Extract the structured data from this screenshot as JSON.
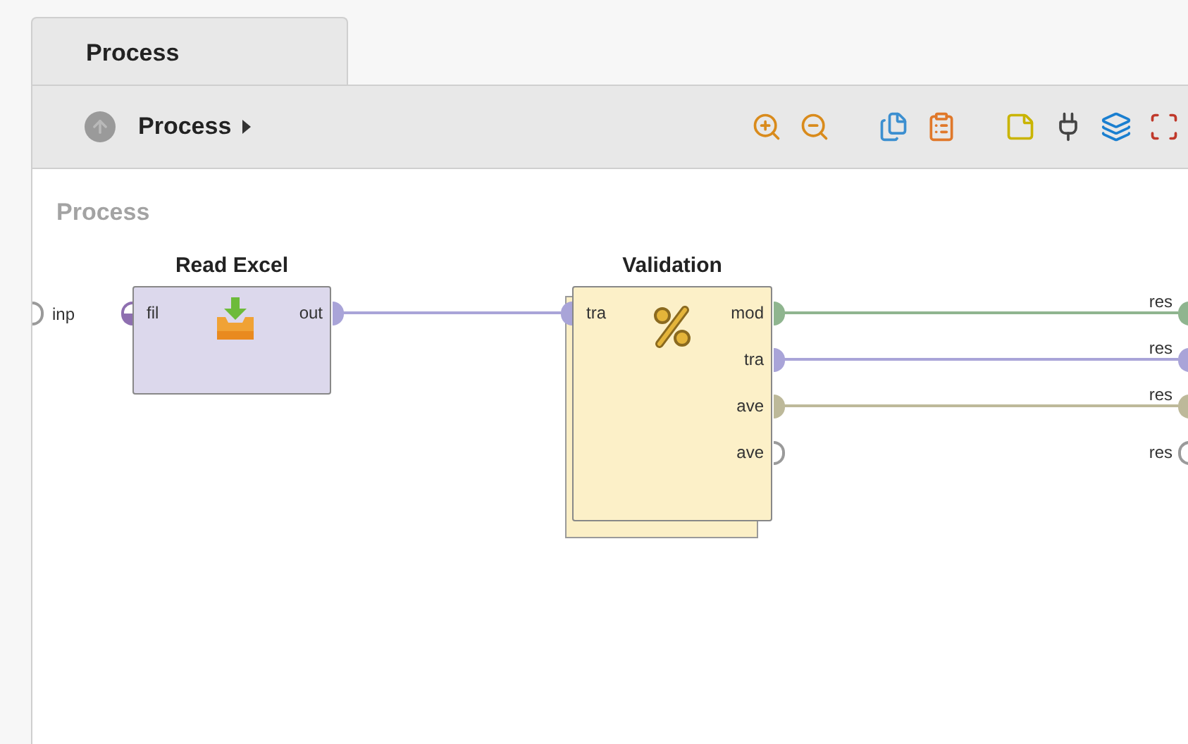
{
  "tabs": [
    {
      "label": "Process",
      "selected": true
    }
  ],
  "breadcrumb": {
    "label": "Process"
  },
  "canvas": {
    "label": "Process",
    "process_inputs": [
      {
        "label": "inp",
        "kind": "empty"
      }
    ],
    "operators": [
      {
        "title": "Read Excel",
        "kind": "read",
        "inputs": [
          {
            "label": "fil",
            "kind": "half",
            "color": "#8e6fb0"
          }
        ],
        "outputs": [
          {
            "label": "out",
            "kind": "full",
            "color": "#a9a4d8",
            "connected": true
          }
        ]
      },
      {
        "title": "Validation",
        "kind": "validation",
        "inputs": [
          {
            "label": "tra",
            "kind": "full",
            "color": "#a9a4d8"
          }
        ],
        "outputs": [
          {
            "label": "mod",
            "kind": "full",
            "color": "#8fb58f",
            "connected": true
          },
          {
            "label": "tra",
            "kind": "full",
            "color": "#a9a4d8",
            "connected": true
          },
          {
            "label": "ave",
            "kind": "full",
            "color": "#bdb99a",
            "connected": true
          },
          {
            "label": "ave",
            "kind": "empty",
            "connected": false
          }
        ]
      }
    ],
    "process_outputs": [
      {
        "label": "res",
        "kind": "full",
        "color": "#8fb58f"
      },
      {
        "label": "res",
        "kind": "full",
        "color": "#a9a4d8"
      },
      {
        "label": "res",
        "kind": "full",
        "color": "#bdb99a"
      },
      {
        "label": "res",
        "kind": "empty"
      }
    ]
  }
}
